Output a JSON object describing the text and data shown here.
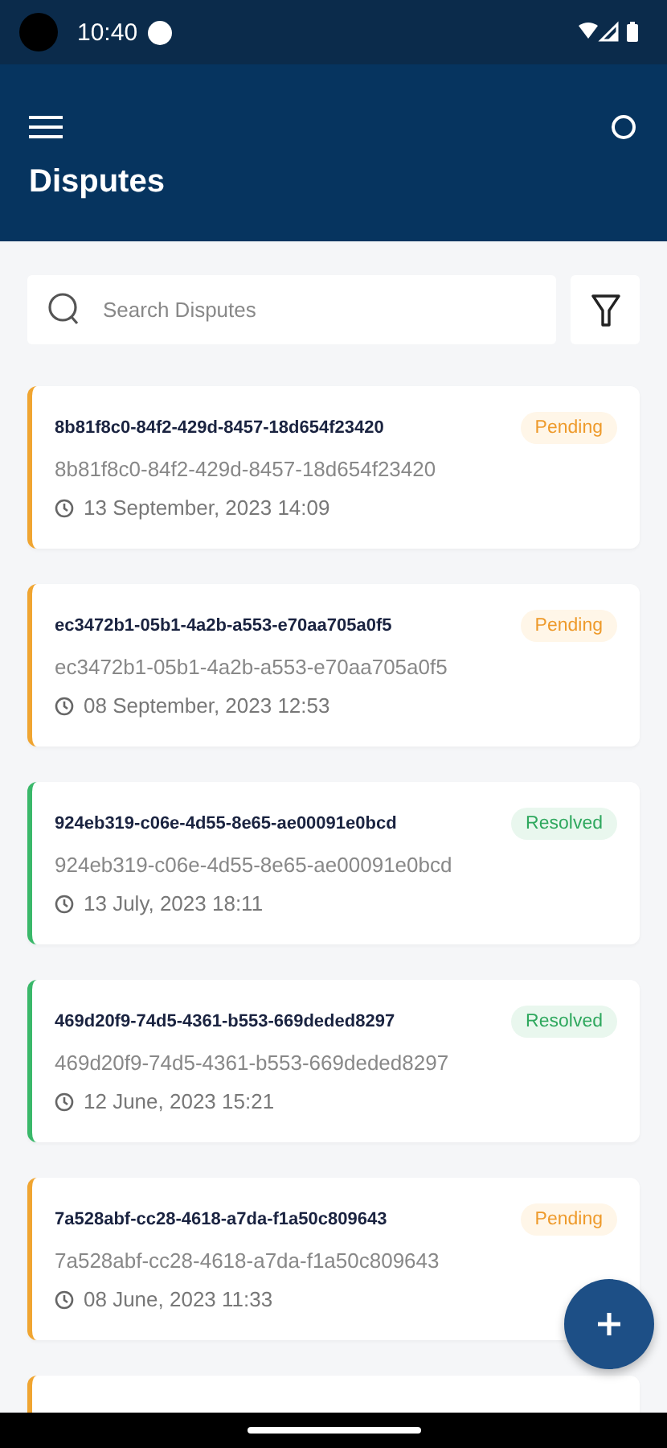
{
  "status_bar": {
    "time": "10:40"
  },
  "header": {
    "title": "Disputes"
  },
  "search": {
    "placeholder": "Search Disputes"
  },
  "disputes": [
    {
      "title": "8b81f8c0-84f2-429d-8457-18d654f23420",
      "subtitle": "8b81f8c0-84f2-429d-8457-18d654f23420",
      "date": "13 September, 2023 14:09",
      "status": {
        "kind": "pending",
        "label": "Pending"
      }
    },
    {
      "title": "ec3472b1-05b1-4a2b-a553-e70aa705a0f5",
      "subtitle": "ec3472b1-05b1-4a2b-a553-e70aa705a0f5",
      "date": "08 September, 2023 12:53",
      "status": {
        "kind": "pending",
        "label": "Pending"
      }
    },
    {
      "title": "924eb319-c06e-4d55-8e65-ae00091e0bcd",
      "subtitle": "924eb319-c06e-4d55-8e65-ae00091e0bcd",
      "date": "13 July, 2023 18:11",
      "status": {
        "kind": "resolved",
        "label": "Resolved"
      }
    },
    {
      "title": "469d20f9-74d5-4361-b553-669deded8297",
      "subtitle": "469d20f9-74d5-4361-b553-669deded8297",
      "date": "12 June, 2023 15:21",
      "status": {
        "kind": "resolved",
        "label": "Resolved"
      }
    },
    {
      "title": "7a528abf-cc28-4618-a7da-f1a50c809643",
      "subtitle": "7a528abf-cc28-4618-a7da-f1a50c809643",
      "date": "08 June, 2023 11:33",
      "status": {
        "kind": "pending",
        "label": "Pending"
      }
    }
  ],
  "partial_card": {
    "color": "#f0a531"
  }
}
